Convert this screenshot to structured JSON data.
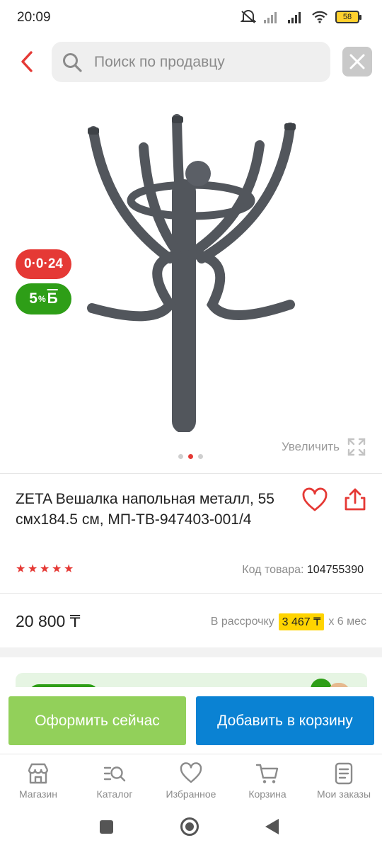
{
  "status_bar": {
    "time": "20:09",
    "battery": "58"
  },
  "search": {
    "placeholder": "Поиск по продавцу"
  },
  "badges": {
    "installment": "0·0·24",
    "bonus_value": "5",
    "bonus_unit": "%",
    "bonus_letter": "Б"
  },
  "gallery": {
    "zoom_label": "Увеличить",
    "slide_count": 3,
    "active_slide": 2
  },
  "product": {
    "title": "ZETA Вешалка напольная металл, 55 смх184.5 см, МП-ТВ-947403-001/4",
    "rating": 5,
    "sku_label": "Код товара:",
    "sku_value": "104755390",
    "price": "20 800 ₸",
    "installment_label": "В рассрочку",
    "installment_amount": "3 467 ₸",
    "installment_term": "х 6 мес"
  },
  "actions": {
    "buy_now": "Оформить сейчас",
    "add_to_cart": "Добавить в корзину"
  },
  "bottom_nav": [
    {
      "label": "Магазин",
      "icon": "store-icon"
    },
    {
      "label": "Каталог",
      "icon": "catalog-search-icon"
    },
    {
      "label": "Избранное",
      "icon": "heart-icon"
    },
    {
      "label": "Корзина",
      "icon": "cart-icon"
    },
    {
      "label": "Мои заказы",
      "icon": "orders-icon"
    }
  ],
  "colors": {
    "accent_red": "#e53935",
    "bonus_green": "#2e9e17",
    "buy_green": "#92d05a",
    "cart_blue": "#0a82d3",
    "installment_yellow": "#ffd400"
  }
}
